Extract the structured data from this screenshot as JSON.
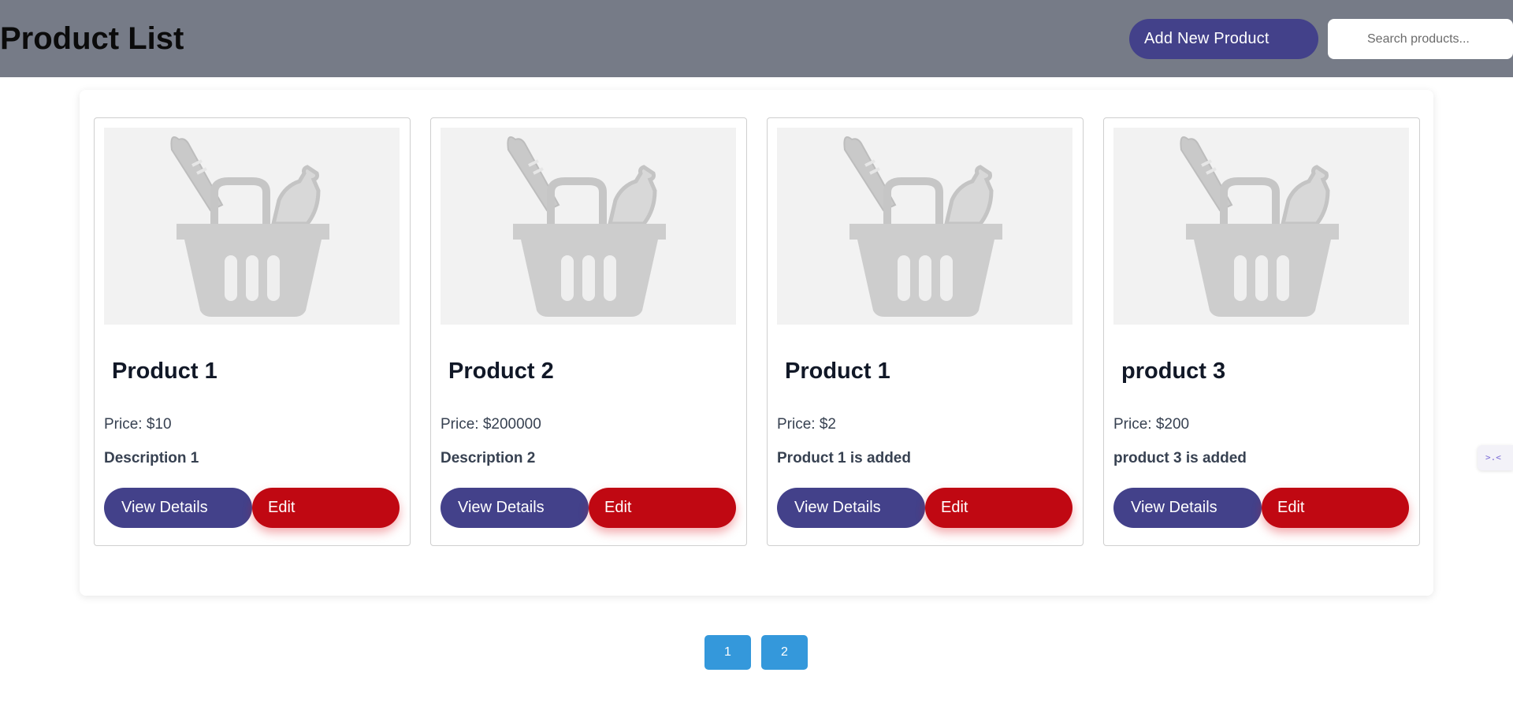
{
  "header": {
    "title": "Product List",
    "add_button_label": "Add New Product",
    "search_placeholder": "Search products..."
  },
  "products": [
    {
      "name": "Product 1",
      "price": "Price: $10",
      "description": "Description 1",
      "view_label": "View Details",
      "edit_label": "Edit"
    },
    {
      "name": "Product 2",
      "price": "Price: $200000",
      "description": "Description 2",
      "view_label": "View Details",
      "edit_label": "Edit"
    },
    {
      "name": "Product 1",
      "price": "Price: $2",
      "description": "Product 1 is added",
      "view_label": "View Details",
      "edit_label": "Edit"
    },
    {
      "name": "product 3",
      "price": "Price: $200",
      "description": "product 3 is added",
      "view_label": "View Details",
      "edit_label": "Edit"
    }
  ],
  "pagination": {
    "pages": [
      "1",
      "2"
    ]
  },
  "side_widget": {
    "icon": "collapse-arrows-icon",
    "glyph": ">.<"
  },
  "colors": {
    "header_bg": "#767b87",
    "primary_button": "#43418a",
    "edit_button": "#c00812",
    "pagination_button": "#3498db"
  }
}
